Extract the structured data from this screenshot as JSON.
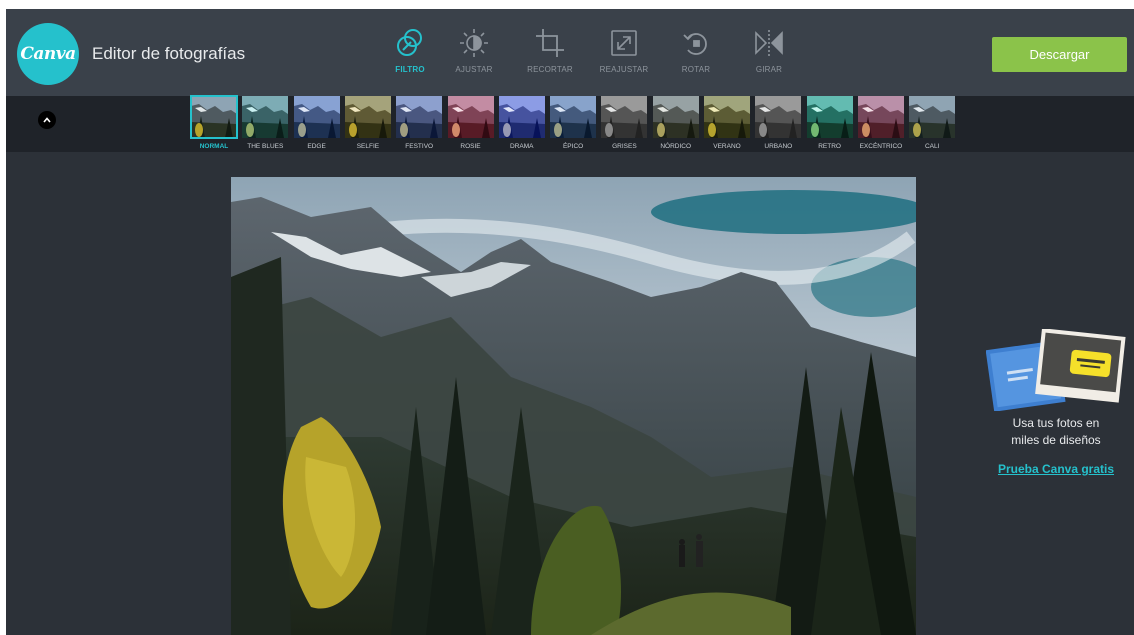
{
  "header": {
    "logo_text": "Canva",
    "title": "Editor de fotografías",
    "download_label": "Descargar"
  },
  "tools": [
    {
      "label": "FILTRO",
      "icon": "filter-icon",
      "active": true
    },
    {
      "label": "AJUSTAR",
      "icon": "brightness-icon",
      "active": false
    },
    {
      "label": "RECORTAR",
      "icon": "crop-icon",
      "active": false
    },
    {
      "label": "REAJUSTAR",
      "icon": "resize-icon",
      "active": false
    },
    {
      "label": "ROTAR",
      "icon": "rotate-icon",
      "active": false
    },
    {
      "label": "GIRAR",
      "icon": "flip-icon",
      "active": false
    }
  ],
  "filters": [
    {
      "label": "NORMAL",
      "active": true
    },
    {
      "label": "THE BLUES",
      "active": false
    },
    {
      "label": "EDGE",
      "active": false
    },
    {
      "label": "SELFIE",
      "active": false
    },
    {
      "label": "FESTIVO",
      "active": false
    },
    {
      "label": "ROSIE",
      "active": false
    },
    {
      "label": "DRAMA",
      "active": false
    },
    {
      "label": "ÉPICO",
      "active": false
    },
    {
      "label": "GRISES",
      "active": false
    },
    {
      "label": "NÓRDICO",
      "active": false
    },
    {
      "label": "VERANO",
      "active": false
    },
    {
      "label": "URBANO",
      "active": false
    },
    {
      "label": "RETRO",
      "active": false
    },
    {
      "label": "EXCÉNTRICO",
      "active": false
    },
    {
      "label": "CALI",
      "active": false
    }
  ],
  "promo": {
    "line1": "Usa tus fotos en",
    "line2": "miles de diseños",
    "link": "Prueba Canva gratis"
  },
  "colors": {
    "accent": "#25c1cc",
    "download": "#8bc34a",
    "header_bg": "#3a414a",
    "body_bg": "#2c3138",
    "strip_bg": "#1f2329"
  }
}
